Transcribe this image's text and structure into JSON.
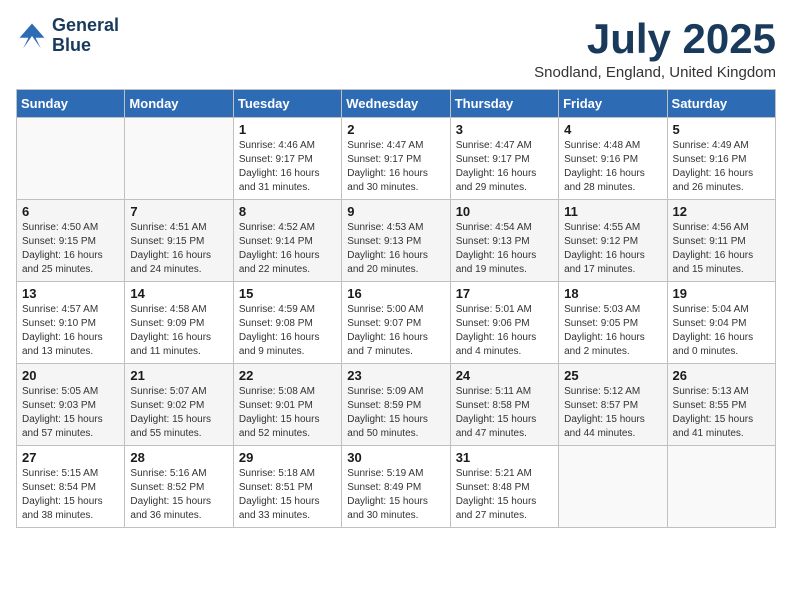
{
  "logo": {
    "line1": "General",
    "line2": "Blue"
  },
  "title": "July 2025",
  "location": "Snodland, England, United Kingdom",
  "days_of_week": [
    "Sunday",
    "Monday",
    "Tuesday",
    "Wednesday",
    "Thursday",
    "Friday",
    "Saturday"
  ],
  "weeks": [
    [
      {
        "day": "",
        "sunrise": "",
        "sunset": "",
        "daylight": ""
      },
      {
        "day": "",
        "sunrise": "",
        "sunset": "",
        "daylight": ""
      },
      {
        "day": "1",
        "sunrise": "Sunrise: 4:46 AM",
        "sunset": "Sunset: 9:17 PM",
        "daylight": "Daylight: 16 hours and 31 minutes."
      },
      {
        "day": "2",
        "sunrise": "Sunrise: 4:47 AM",
        "sunset": "Sunset: 9:17 PM",
        "daylight": "Daylight: 16 hours and 30 minutes."
      },
      {
        "day": "3",
        "sunrise": "Sunrise: 4:47 AM",
        "sunset": "Sunset: 9:17 PM",
        "daylight": "Daylight: 16 hours and 29 minutes."
      },
      {
        "day": "4",
        "sunrise": "Sunrise: 4:48 AM",
        "sunset": "Sunset: 9:16 PM",
        "daylight": "Daylight: 16 hours and 28 minutes."
      },
      {
        "day": "5",
        "sunrise": "Sunrise: 4:49 AM",
        "sunset": "Sunset: 9:16 PM",
        "daylight": "Daylight: 16 hours and 26 minutes."
      }
    ],
    [
      {
        "day": "6",
        "sunrise": "Sunrise: 4:50 AM",
        "sunset": "Sunset: 9:15 PM",
        "daylight": "Daylight: 16 hours and 25 minutes."
      },
      {
        "day": "7",
        "sunrise": "Sunrise: 4:51 AM",
        "sunset": "Sunset: 9:15 PM",
        "daylight": "Daylight: 16 hours and 24 minutes."
      },
      {
        "day": "8",
        "sunrise": "Sunrise: 4:52 AM",
        "sunset": "Sunset: 9:14 PM",
        "daylight": "Daylight: 16 hours and 22 minutes."
      },
      {
        "day": "9",
        "sunrise": "Sunrise: 4:53 AM",
        "sunset": "Sunset: 9:13 PM",
        "daylight": "Daylight: 16 hours and 20 minutes."
      },
      {
        "day": "10",
        "sunrise": "Sunrise: 4:54 AM",
        "sunset": "Sunset: 9:13 PM",
        "daylight": "Daylight: 16 hours and 19 minutes."
      },
      {
        "day": "11",
        "sunrise": "Sunrise: 4:55 AM",
        "sunset": "Sunset: 9:12 PM",
        "daylight": "Daylight: 16 hours and 17 minutes."
      },
      {
        "day": "12",
        "sunrise": "Sunrise: 4:56 AM",
        "sunset": "Sunset: 9:11 PM",
        "daylight": "Daylight: 16 hours and 15 minutes."
      }
    ],
    [
      {
        "day": "13",
        "sunrise": "Sunrise: 4:57 AM",
        "sunset": "Sunset: 9:10 PM",
        "daylight": "Daylight: 16 hours and 13 minutes."
      },
      {
        "day": "14",
        "sunrise": "Sunrise: 4:58 AM",
        "sunset": "Sunset: 9:09 PM",
        "daylight": "Daylight: 16 hours and 11 minutes."
      },
      {
        "day": "15",
        "sunrise": "Sunrise: 4:59 AM",
        "sunset": "Sunset: 9:08 PM",
        "daylight": "Daylight: 16 hours and 9 minutes."
      },
      {
        "day": "16",
        "sunrise": "Sunrise: 5:00 AM",
        "sunset": "Sunset: 9:07 PM",
        "daylight": "Daylight: 16 hours and 7 minutes."
      },
      {
        "day": "17",
        "sunrise": "Sunrise: 5:01 AM",
        "sunset": "Sunset: 9:06 PM",
        "daylight": "Daylight: 16 hours and 4 minutes."
      },
      {
        "day": "18",
        "sunrise": "Sunrise: 5:03 AM",
        "sunset": "Sunset: 9:05 PM",
        "daylight": "Daylight: 16 hours and 2 minutes."
      },
      {
        "day": "19",
        "sunrise": "Sunrise: 5:04 AM",
        "sunset": "Sunset: 9:04 PM",
        "daylight": "Daylight: 16 hours and 0 minutes."
      }
    ],
    [
      {
        "day": "20",
        "sunrise": "Sunrise: 5:05 AM",
        "sunset": "Sunset: 9:03 PM",
        "daylight": "Daylight: 15 hours and 57 minutes."
      },
      {
        "day": "21",
        "sunrise": "Sunrise: 5:07 AM",
        "sunset": "Sunset: 9:02 PM",
        "daylight": "Daylight: 15 hours and 55 minutes."
      },
      {
        "day": "22",
        "sunrise": "Sunrise: 5:08 AM",
        "sunset": "Sunset: 9:01 PM",
        "daylight": "Daylight: 15 hours and 52 minutes."
      },
      {
        "day": "23",
        "sunrise": "Sunrise: 5:09 AM",
        "sunset": "Sunset: 8:59 PM",
        "daylight": "Daylight: 15 hours and 50 minutes."
      },
      {
        "day": "24",
        "sunrise": "Sunrise: 5:11 AM",
        "sunset": "Sunset: 8:58 PM",
        "daylight": "Daylight: 15 hours and 47 minutes."
      },
      {
        "day": "25",
        "sunrise": "Sunrise: 5:12 AM",
        "sunset": "Sunset: 8:57 PM",
        "daylight": "Daylight: 15 hours and 44 minutes."
      },
      {
        "day": "26",
        "sunrise": "Sunrise: 5:13 AM",
        "sunset": "Sunset: 8:55 PM",
        "daylight": "Daylight: 15 hours and 41 minutes."
      }
    ],
    [
      {
        "day": "27",
        "sunrise": "Sunrise: 5:15 AM",
        "sunset": "Sunset: 8:54 PM",
        "daylight": "Daylight: 15 hours and 38 minutes."
      },
      {
        "day": "28",
        "sunrise": "Sunrise: 5:16 AM",
        "sunset": "Sunset: 8:52 PM",
        "daylight": "Daylight: 15 hours and 36 minutes."
      },
      {
        "day": "29",
        "sunrise": "Sunrise: 5:18 AM",
        "sunset": "Sunset: 8:51 PM",
        "daylight": "Daylight: 15 hours and 33 minutes."
      },
      {
        "day": "30",
        "sunrise": "Sunrise: 5:19 AM",
        "sunset": "Sunset: 8:49 PM",
        "daylight": "Daylight: 15 hours and 30 minutes."
      },
      {
        "day": "31",
        "sunrise": "Sunrise: 5:21 AM",
        "sunset": "Sunset: 8:48 PM",
        "daylight": "Daylight: 15 hours and 27 minutes."
      },
      {
        "day": "",
        "sunrise": "",
        "sunset": "",
        "daylight": ""
      },
      {
        "day": "",
        "sunrise": "",
        "sunset": "",
        "daylight": ""
      }
    ]
  ]
}
